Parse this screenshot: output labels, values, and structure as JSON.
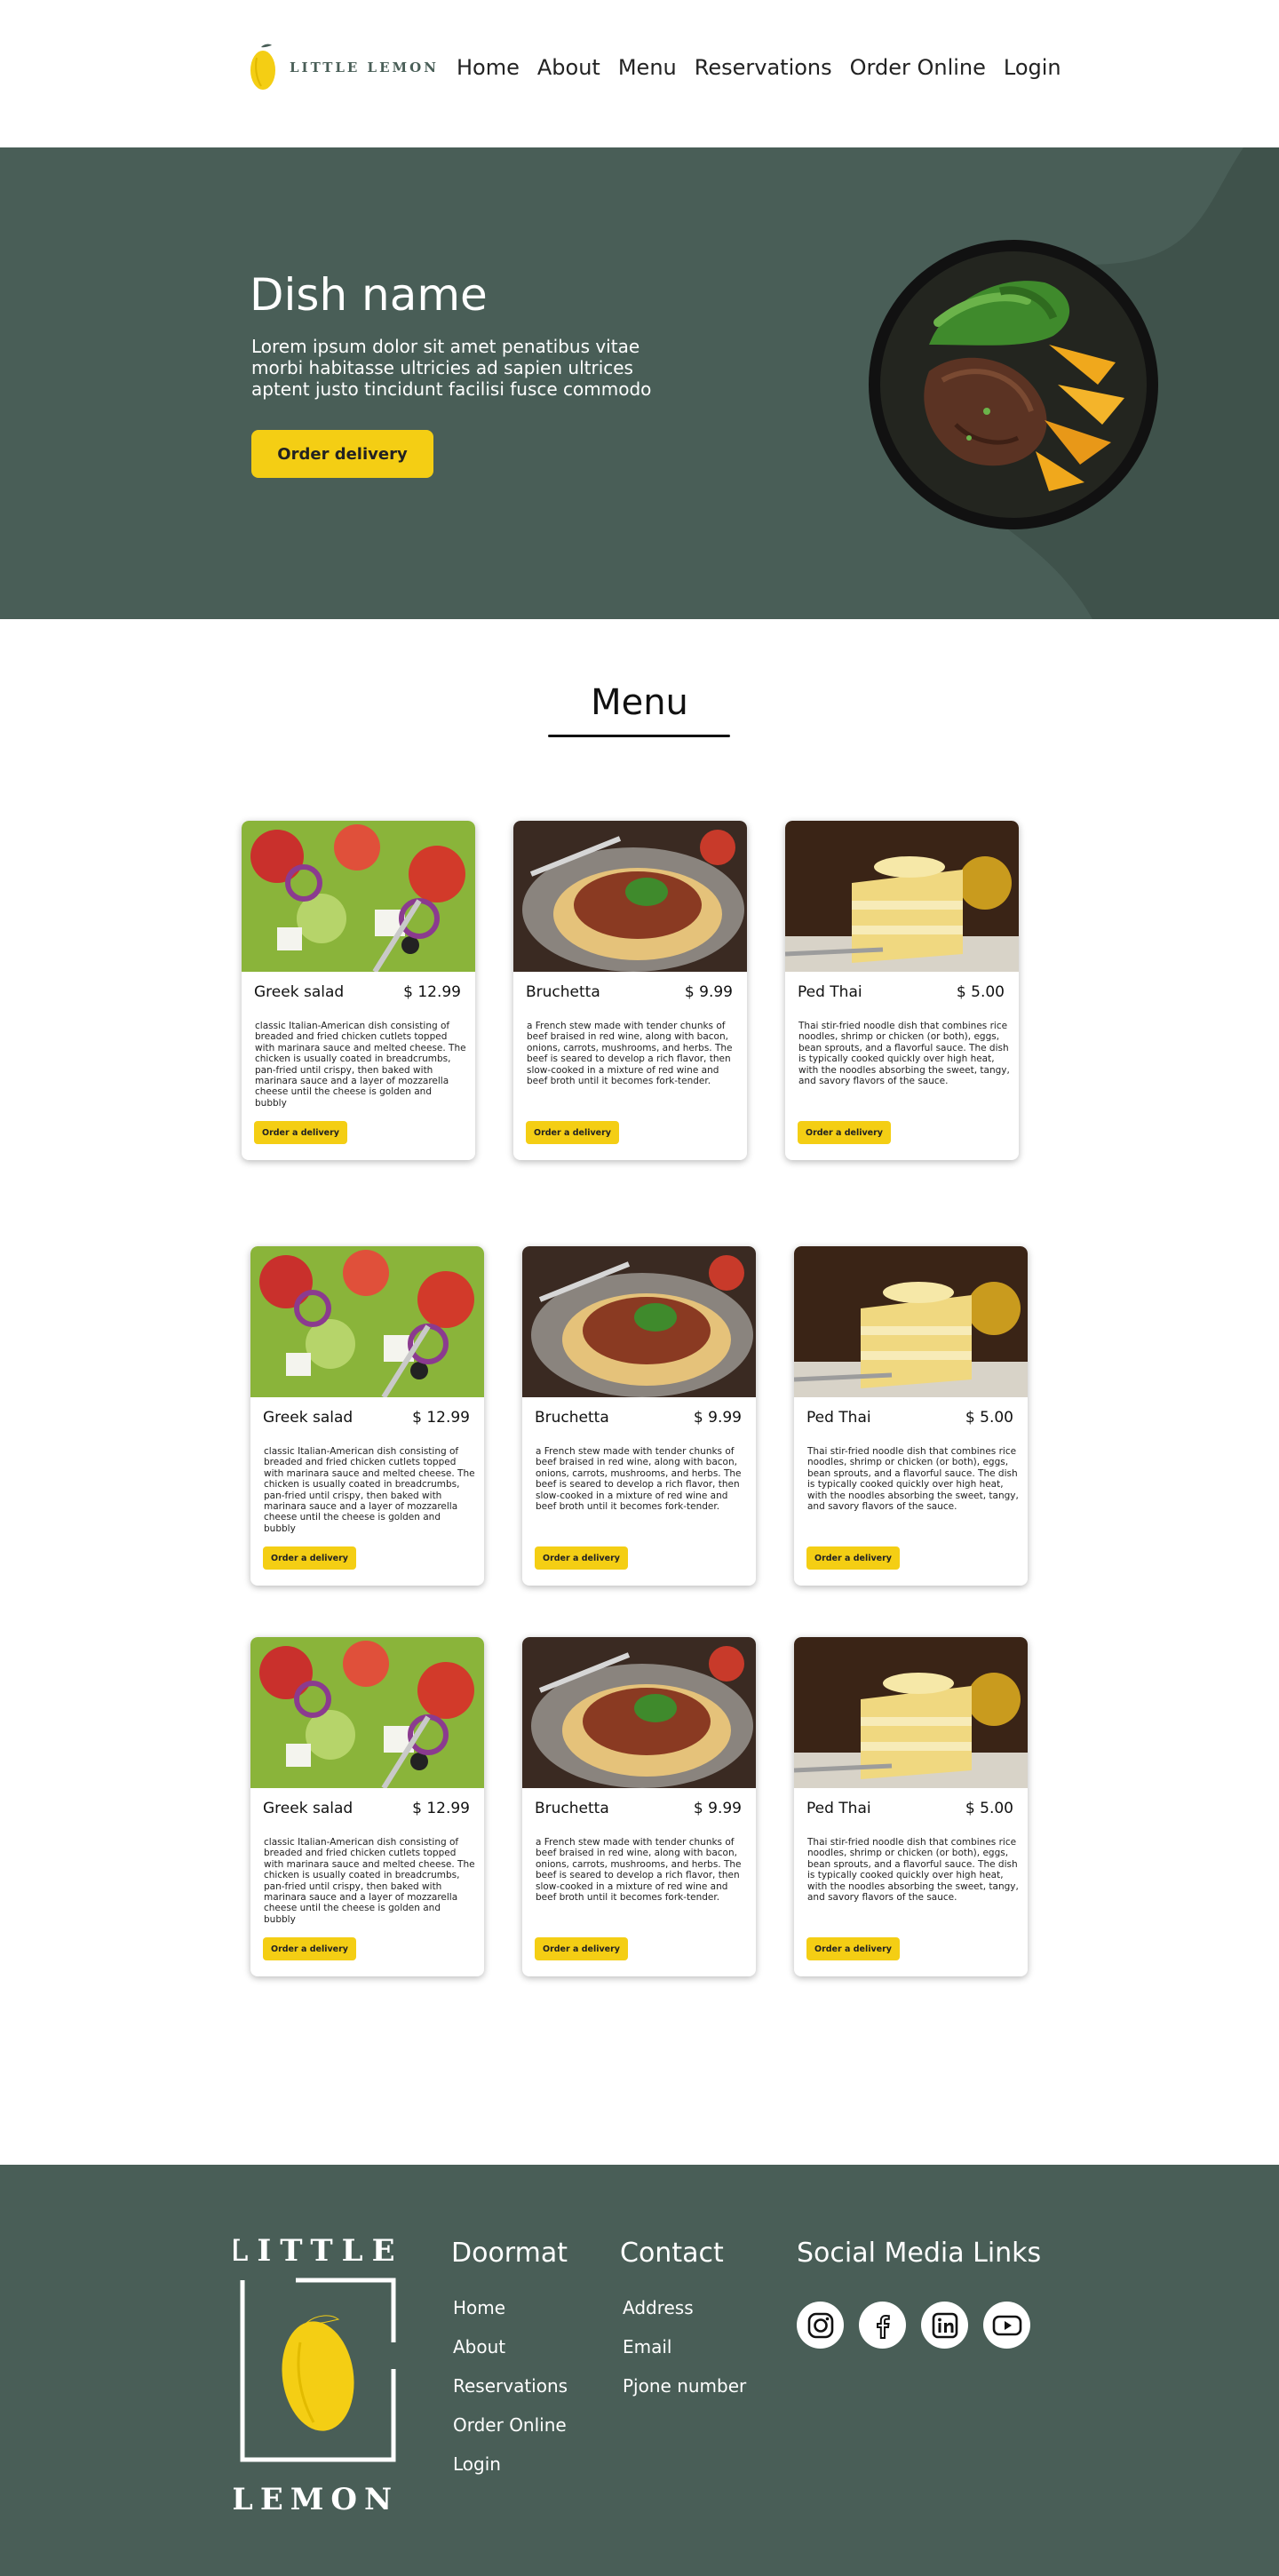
{
  "brand": {
    "name": "LITTLE LEMON",
    "footer_word_1": "LITTLE",
    "footer_word_2": "LEMON"
  },
  "nav": {
    "items": [
      {
        "label": "Home"
      },
      {
        "label": "About"
      },
      {
        "label": "Menu"
      },
      {
        "label": "Reservations"
      },
      {
        "label": "Order Online"
      },
      {
        "label": "Login"
      }
    ]
  },
  "hero": {
    "title": "Dish name",
    "description": "Lorem ipsum dolor sit amet penatibus vitae morbi habitasse ultricies ad sapien ultrices aptent justo tincidunt facilisi fusce commodo",
    "button_label": "Order delivery"
  },
  "menu": {
    "heading": "Menu",
    "rows": [
      [
        {
          "name": "Greek salad",
          "price": "$ 12.99",
          "image": "salad",
          "description": "classic Italian-American dish consisting of breaded and fried chicken cutlets topped with marinara sauce and melted cheese. The chicken is usually coated in breadcrumbs, pan-fried until crispy, then baked with marinara sauce and a layer of mozzarella cheese until the cheese is golden and bubbly",
          "button_label": "Order a delivery"
        },
        {
          "name": "Bruchetta",
          "price": "$ 9.99",
          "image": "pasta",
          "description": "a French stew made with tender chunks of beef braised in red wine, along with bacon, onions, carrots, mushrooms, and herbs. The beef is seared to develop a rich flavor, then slow-cooked in a mixture of red wine and beef broth until it becomes fork-tender.",
          "button_label": "Order a delivery"
        },
        {
          "name": "Ped Thai",
          "price": "$ 5.00",
          "image": "cake",
          "description": "Thai stir-fried noodle dish that combines rice noodles, shrimp or chicken (or both), eggs, bean sprouts, and a flavorful sauce. The dish is typically cooked quickly over high heat, with the noodles absorbing the sweet, tangy, and savory flavors of the sauce.",
          "button_label": "Order a delivery"
        }
      ],
      [
        {
          "name": "Greek salad",
          "price": "$ 12.99",
          "image": "salad",
          "description": "classic Italian-American dish consisting of breaded and fried chicken cutlets topped with marinara sauce and melted cheese. The chicken is usually coated in breadcrumbs, pan-fried until crispy, then baked with marinara sauce and a layer of mozzarella cheese until the cheese is golden and bubbly",
          "button_label": "Order a delivery"
        },
        {
          "name": "Bruchetta",
          "price": "$ 9.99",
          "image": "pasta",
          "description": "a French stew made with tender chunks of beef braised in red wine, along with bacon, onions, carrots, mushrooms, and herbs. The beef is seared to develop a rich flavor, then slow-cooked in a mixture of red wine and beef broth until it becomes fork-tender.",
          "button_label": "Order a delivery"
        },
        {
          "name": "Ped Thai",
          "price": "$ 5.00",
          "image": "cake",
          "description": "Thai stir-fried noodle dish that combines rice noodles, shrimp or chicken (or both), eggs, bean sprouts, and a flavorful sauce. The dish is typically cooked quickly over high heat, with the noodles absorbing the sweet, tangy, and savory flavors of the sauce.",
          "button_label": "Order a delivery"
        }
      ],
      [
        {
          "name": "Greek salad",
          "price": "$ 12.99",
          "image": "salad",
          "description": "classic Italian-American dish consisting of breaded and fried chicken cutlets topped with marinara sauce and melted cheese. The chicken is usually coated in breadcrumbs, pan-fried until crispy, then baked with marinara sauce and a layer of mozzarella cheese until the cheese is golden and bubbly",
          "button_label": "Order a delivery"
        },
        {
          "name": "Bruchetta",
          "price": "$ 9.99",
          "image": "pasta",
          "description": "a French stew made with tender chunks of beef braised in red wine, along with bacon, onions, carrots, mushrooms, and herbs. The beef is seared to develop a rich flavor, then slow-cooked in a mixture of red wine and beef broth until it becomes fork-tender.",
          "button_label": "Order a delivery"
        },
        {
          "name": "Ped Thai",
          "price": "$ 5.00",
          "image": "cake",
          "description": "Thai stir-fried noodle dish that combines rice noodles, shrimp or chicken (or both), eggs, bean sprouts, and a flavorful sauce. The dish is typically cooked quickly over high heat, with the noodles absorbing the sweet, tangy, and savory flavors of the sauce.",
          "button_label": "Order a delivery"
        }
      ]
    ]
  },
  "footer": {
    "doormat": {
      "title": "Doormat",
      "items": [
        "Home",
        "About",
        "Reservations",
        "Order Online",
        "Login"
      ]
    },
    "contact": {
      "title": "Contact",
      "items": [
        "Address",
        "Email",
        "Pjone number"
      ]
    },
    "social": {
      "title": "Social Media Links",
      "icons": [
        "instagram-icon",
        "facebook-icon",
        "linkedin-icon",
        "youtube-icon"
      ]
    }
  },
  "colors": {
    "primary_green": "#495e57",
    "accent_yellow": "#f4ce14",
    "text_dark": "#111111",
    "white": "#ffffff"
  }
}
